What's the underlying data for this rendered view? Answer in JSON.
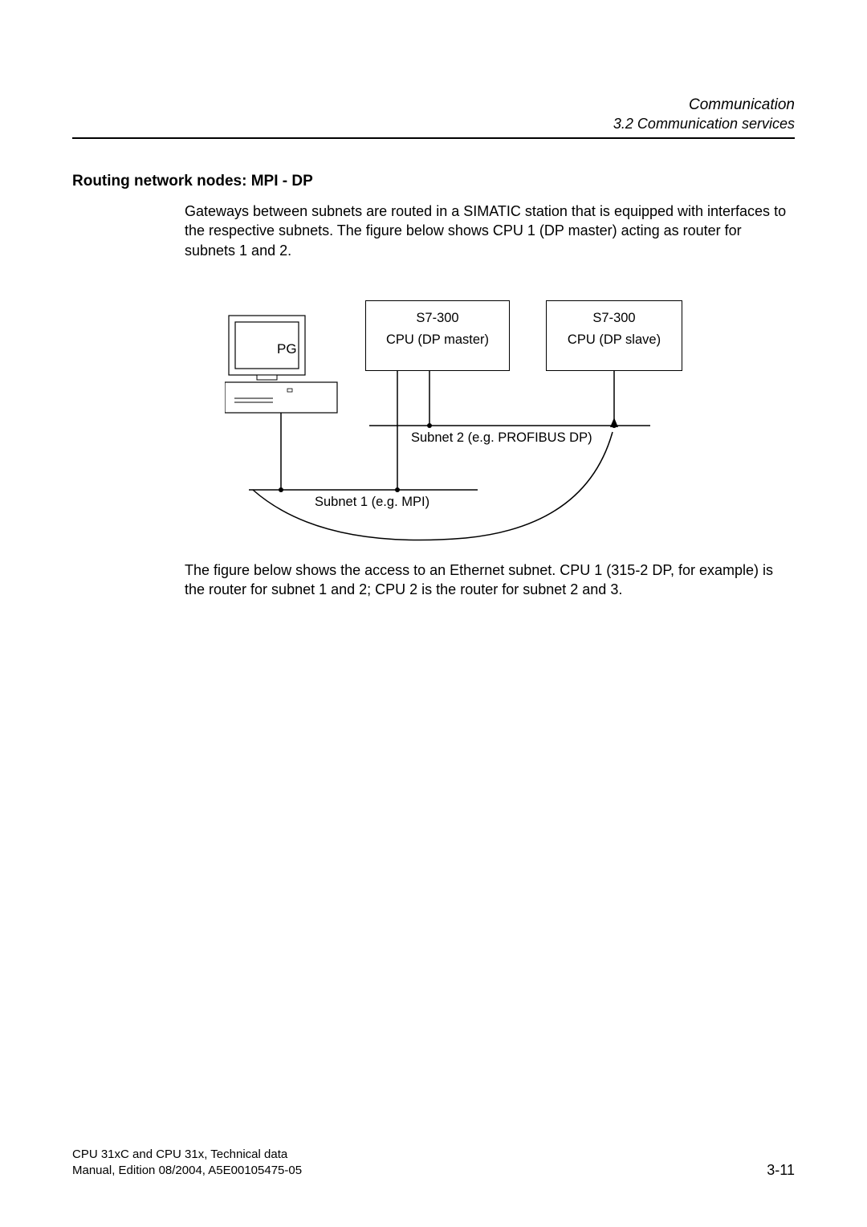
{
  "header": {
    "chapter": "Communication",
    "section": "3.2 Communication services"
  },
  "heading": "Routing network nodes: MPI - DP",
  "para1": "Gateways between subnets are routed in a SIMATIC station that is equipped with interfaces to the respective subnets. The figure below shows CPU 1 (DP master) acting as router for subnets 1 and 2.",
  "diagram": {
    "pg_label": "PG",
    "box_master_l1": "S7-300",
    "box_master_l2": "CPU (DP master)",
    "box_slave_l1": "S7-300",
    "box_slave_l2": "CPU (DP slave)",
    "subnet2": "Subnet 2 (e.g. PROFIBUS DP)",
    "subnet1": "Subnet 1 (e.g. MPI)"
  },
  "para2": "The figure below shows the access to an Ethernet subnet. CPU 1 (315-2 DP, for example) is the router for subnet 1 and 2; CPU 2 is the router for subnet 2 and 3.",
  "footer": {
    "line1": "CPU 31xC and CPU 31x, Technical data",
    "line2": "Manual, Edition 08/2004, A5E00105475-05",
    "pagenum": "3-11"
  }
}
